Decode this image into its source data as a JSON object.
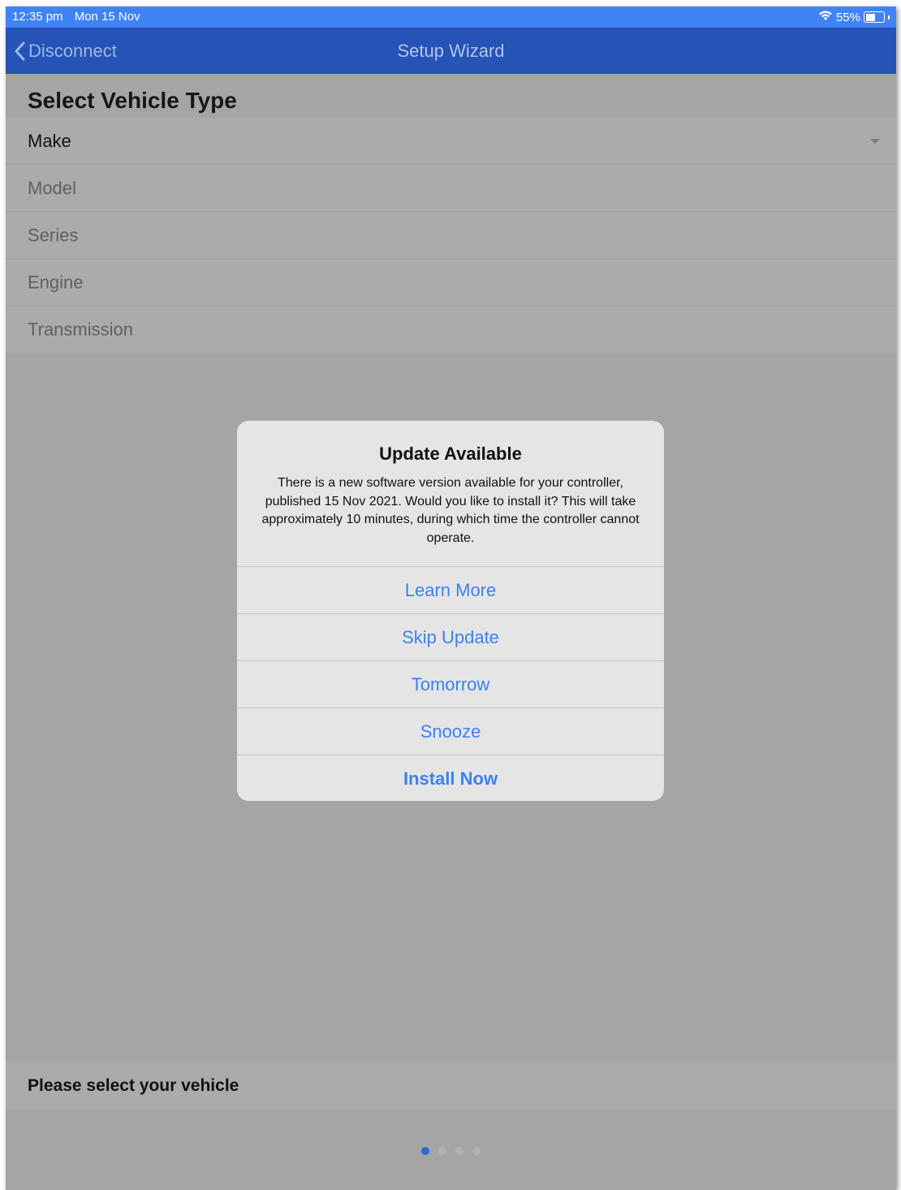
{
  "status_bar": {
    "time": "12:35 pm",
    "date": "Mon 15 Nov",
    "wifi_icon": "wifi-icon",
    "battery_percent": "55%",
    "battery_level": 0.55
  },
  "nav": {
    "back_label": "Disconnect",
    "title": "Setup Wizard"
  },
  "vehicle": {
    "section_title": "Select Vehicle Type",
    "fields": [
      {
        "label": "Make"
      },
      {
        "label": "Model"
      },
      {
        "label": "Series"
      },
      {
        "label": "Engine"
      },
      {
        "label": "Transmission"
      }
    ]
  },
  "dialog": {
    "title": "Update Available",
    "message": "There is a new software version available for your controller, published 15 Nov 2021. Would you like to install it? This will take approximately 10 minutes, during which time the controller cannot operate.",
    "buttons": [
      {
        "label": "Learn More"
      },
      {
        "label": "Skip Update"
      },
      {
        "label": "Tomorrow"
      },
      {
        "label": "Snooze"
      },
      {
        "label": "Install Now"
      }
    ]
  },
  "footer": {
    "text": "Please select your vehicle"
  },
  "pager": {
    "current_page": 1,
    "total_pages": 4
  },
  "colors": {
    "status_bar": "#3f83f6",
    "nav_bar": "#2553b6",
    "dialog_button_text": "#3a82f0",
    "page_dot_active": "#2d66d6"
  }
}
